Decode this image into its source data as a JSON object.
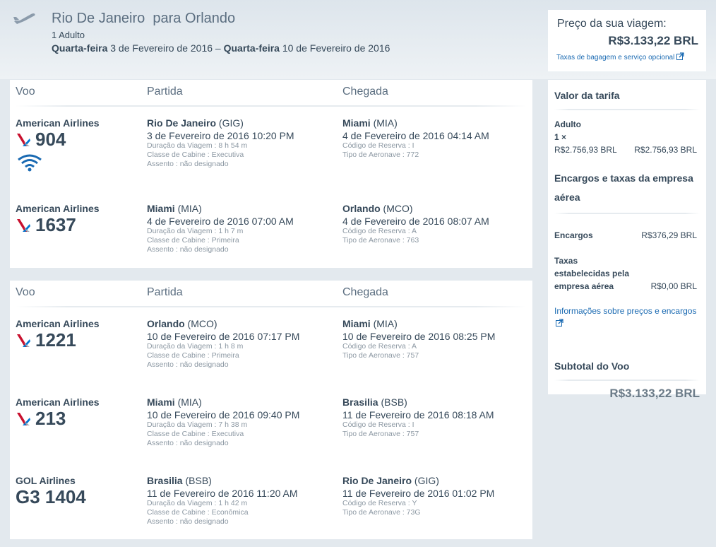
{
  "trip": {
    "route": "Rio De Janeiro  para Orlando",
    "passengers": "1 Adulto",
    "depart_day": "Quarta-feira",
    "depart_date": " 3 de Fevereiro de 2016 – ",
    "return_day": "Quarta-feira",
    "return_date": " 10 de Fevereiro de 2016"
  },
  "price_box": {
    "label": "Preço da sua viagem:",
    "amount": "R$3.133,22 BRL",
    "baggage_link": "Taxas de bagagem e serviço opcional"
  },
  "columns": {
    "flight": "Voo",
    "departure": "Partida",
    "arrival": "Chegada"
  },
  "outbound": [
    {
      "airline": "American Airlines",
      "logo": "aa-logo-icon",
      "flight_number": "904",
      "wifi": true,
      "dep_city": "Rio De Janeiro",
      "dep_code": " (GIG)",
      "dep_time": "3 de Fevereiro de 2016 10:20 PM",
      "duration": "Duração da Viagem : 8 h 54 m",
      "cabin": "Classe de Cabine : Executiva",
      "seat": "Assento : não designado",
      "arr_city": "Miami",
      "arr_code": " (MIA)",
      "arr_time": "4 de Fevereiro de 2016 04:14 AM",
      "booking": "Código de Reserva : I",
      "aircraft": "Tipo de Aeronave : 772"
    },
    {
      "airline": "American Airlines",
      "logo": "aa-logo-icon",
      "flight_number": "1637",
      "wifi": false,
      "dep_city": "Miami",
      "dep_code": " (MIA)",
      "dep_time": "4 de Fevereiro de 2016 07:00 AM",
      "duration": "Duração da Viagem : 1 h 7 m",
      "cabin": "Classe de Cabine : Primeira",
      "seat": "Assento : não designado",
      "arr_city": "Orlando",
      "arr_code": " (MCO)",
      "arr_time": "4 de Fevereiro de 2016 08:07 AM",
      "booking": "Código de Reserva : A",
      "aircraft": "Tipo de Aeronave : 763"
    }
  ],
  "return": [
    {
      "airline": "American Airlines",
      "logo": "aa-logo-icon",
      "flight_number": "1221",
      "wifi": false,
      "dep_city": "Orlando",
      "dep_code": " (MCO)",
      "dep_time": "10 de Fevereiro de 2016 07:17 PM",
      "duration": "Duração da Viagem : 1 h 8 m",
      "cabin": "Classe de Cabine : Primeira",
      "seat": "Assento : não designado",
      "arr_city": "Miami",
      "arr_code": " (MIA)",
      "arr_time": "10 de Fevereiro de 2016 08:25 PM",
      "booking": "Código de Reserva : A",
      "aircraft": "Tipo de Aeronave : 757"
    },
    {
      "airline": "American Airlines",
      "logo": "aa-logo-icon",
      "flight_number": "213",
      "wifi": false,
      "dep_city": "Miami",
      "dep_code": " (MIA)",
      "dep_time": "10 de Fevereiro de 2016 09:40 PM",
      "duration": "Duração da Viagem : 7 h 38 m",
      "cabin": "Classe de Cabine : Executiva",
      "seat": "Assento : não designado",
      "arr_city": "Brasilia",
      "arr_code": " (BSB)",
      "arr_time": "11 de Fevereiro de 2016 08:18 AM",
      "booking": "Código de Reserva : I",
      "aircraft": "Tipo de Aeronave : 757"
    },
    {
      "airline": "GOL Airlines",
      "logo": "",
      "flight_number": "G3 1404",
      "wifi": false,
      "dep_city": "Brasilia",
      "dep_code": " (BSB)",
      "dep_time": "11 de Fevereiro de 2016 11:20 AM",
      "duration": "Duração da Viagem : 1 h 42 m",
      "cabin": "Classe de Cabine : Econômica",
      "seat": "Assento : não designado",
      "arr_city": "Rio De Janeiro",
      "arr_code": " (GIG)",
      "arr_time": "11 de Fevereiro de 2016 01:02 PM",
      "booking": "Código de Reserva : Y",
      "aircraft": "Tipo de Aeronave : 73G"
    }
  ],
  "fare": {
    "title": "Valor da tarifa",
    "adult_label": "Adulto",
    "adult_qty": "1 ×",
    "adult_unit": "R$2.756,93 BRL",
    "adult_total": "R$2.756,93 BRL",
    "taxes_title_line1": "Encargos e taxas da empresa",
    "taxes_title_line2": "aérea",
    "charges_label": "Encargos",
    "charges_value": "R$376,29 BRL",
    "carrier_taxes_line1": "Taxas",
    "carrier_taxes_line2": "estabelecidas pela",
    "carrier_taxes_line3": "empresa aérea",
    "carrier_taxes_value": "R$0,00 BRL",
    "info_link": "Informações sobre preços e encargos",
    "subtotal_label": "Subtotal do Voo",
    "subtotal_value": "R$3.133,22 BRL"
  },
  "colors": {
    "link": "#1a6ab2",
    "text": "#36495a",
    "aa_red": "#c8102e",
    "aa_blue": "#0078d2"
  }
}
